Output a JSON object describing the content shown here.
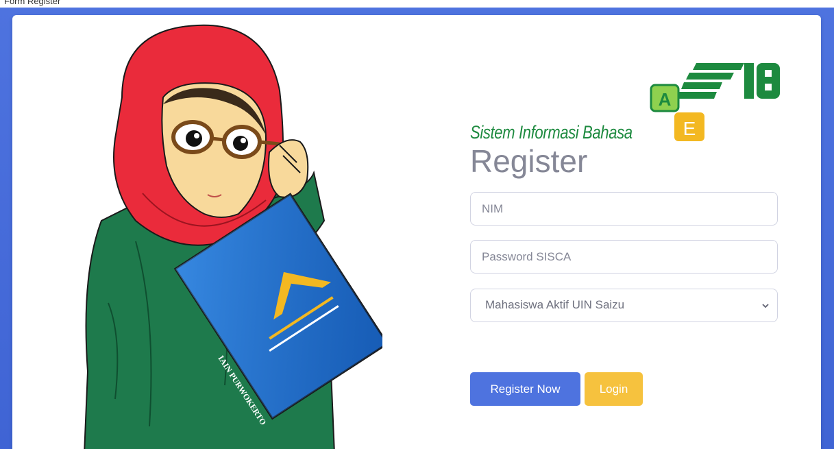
{
  "top_strip": {
    "text": "Form Register"
  },
  "brand": {
    "name": "Sistem Informasi Bahasa",
    "logo_text": "SIB",
    "logo_letters": [
      "A",
      "E"
    ]
  },
  "illustration": {
    "book_text": "IAIN PURWOKERTO"
  },
  "form": {
    "title": "Register",
    "nim_placeholder": "NIM",
    "password_placeholder": "Password SISCA",
    "status_select": {
      "selected": "Mahasiswa Aktif UIN Saizu"
    },
    "register_button": "Register Now",
    "login_button": "Login"
  },
  "colors": {
    "background": "#4e73df",
    "primary": "#4e73df",
    "warning": "#f6c23e",
    "brand_green": "#1d8a3f"
  }
}
